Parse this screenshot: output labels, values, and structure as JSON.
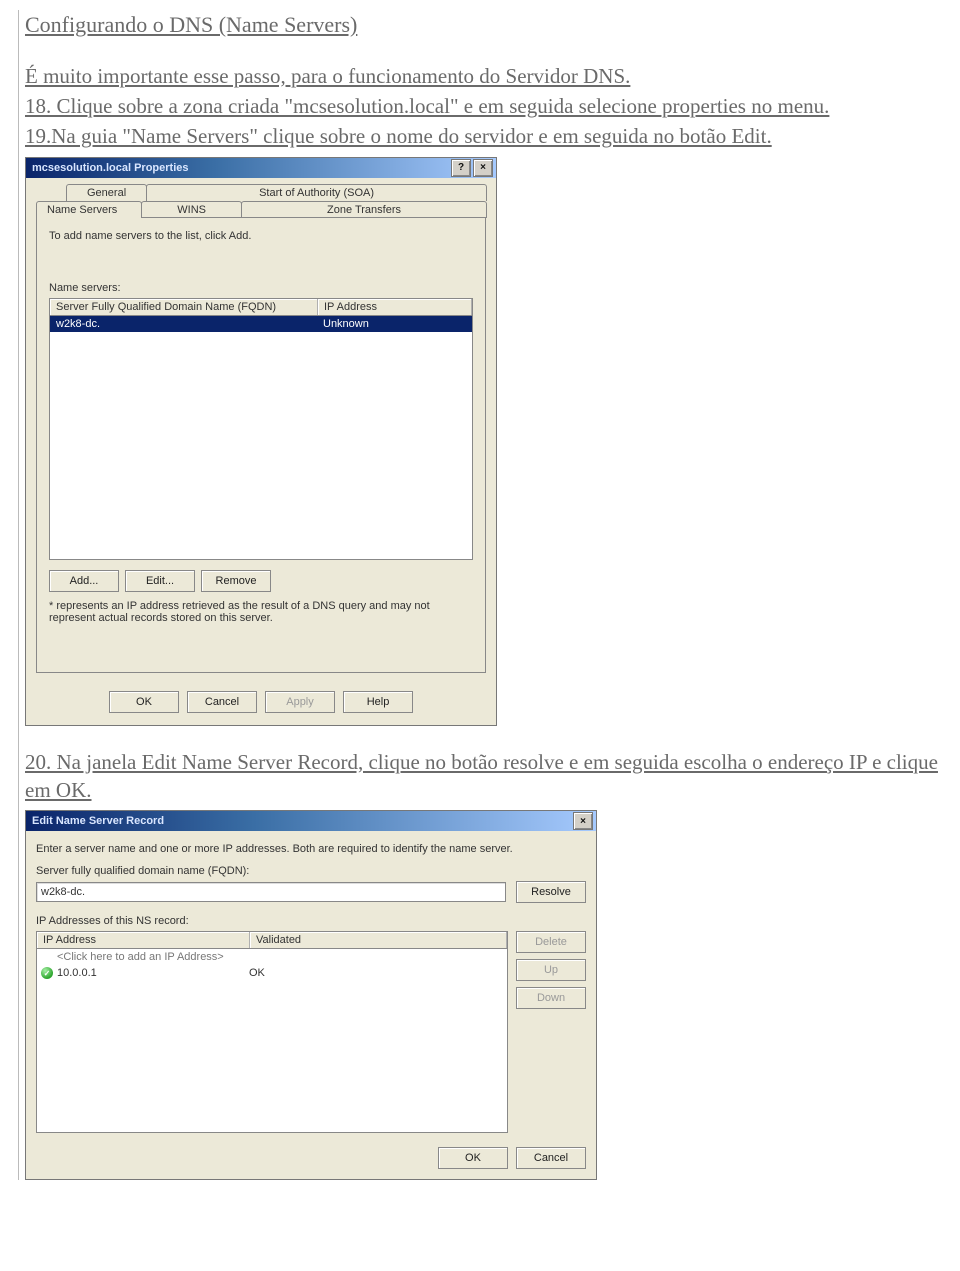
{
  "doc": {
    "title": "Configurando o DNS (Name Servers)",
    "p1": "É muito importante esse passo, para o funcionamento do Servidor DNS.",
    "p2": "18. Clique sobre a zona criada \"mcsesolution.local\" e em seguida selecione properties no menu.",
    "p3": "19.Na guia \"Name Servers\" clique sobre o nome do servidor e em seguida no botão Edit.",
    "p4": "20. Na janela Edit Name Server Record, clique no botão resolve e em seguida escolha o endereço IP e clique em OK."
  },
  "dlg1": {
    "title": "mcsesolution.local Properties",
    "help_btn": "?",
    "close_btn": "×",
    "tabs_back": {
      "general": "General",
      "soa": "Start of Authority (SOA)"
    },
    "tabs_front": {
      "ns": "Name Servers",
      "wins": "WINS",
      "zt": "Zone Transfers"
    },
    "add_hint": "To add name servers to the list, click Add.",
    "ns_label": "Name servers:",
    "cols": {
      "fqdn": "Server Fully Qualified Domain Name (FQDN)",
      "ip": "IP Address"
    },
    "row": {
      "fqdn": "w2k8-dc.",
      "ip": "Unknown"
    },
    "btn_add": "Add...",
    "btn_edit": "Edit...",
    "btn_remove": "Remove",
    "footnote": "* represents an IP address retrieved as the result of a DNS query and may not represent actual records stored on this server.",
    "btn_ok": "OK",
    "btn_cancel": "Cancel",
    "btn_apply": "Apply",
    "btn_help": "Help"
  },
  "dlg2": {
    "title": "Edit Name Server Record",
    "close_btn": "×",
    "instr": "Enter a server name and one or more IP addresses. Both are required to identify the name server.",
    "fqdn_label": "Server fully qualified domain name (FQDN):",
    "fqdn_value": "w2k8-dc.",
    "btn_resolve": "Resolve",
    "list_label": "IP Addresses of this NS record:",
    "cols": {
      "ip": "IP Address",
      "val": "Validated"
    },
    "hint_row": "<Click here to add an IP Address>",
    "row": {
      "ip": "10.0.0.1",
      "val": "OK"
    },
    "btn_delete": "Delete",
    "btn_up": "Up",
    "btn_down": "Down",
    "btn_ok": "OK",
    "btn_cancel": "Cancel"
  }
}
